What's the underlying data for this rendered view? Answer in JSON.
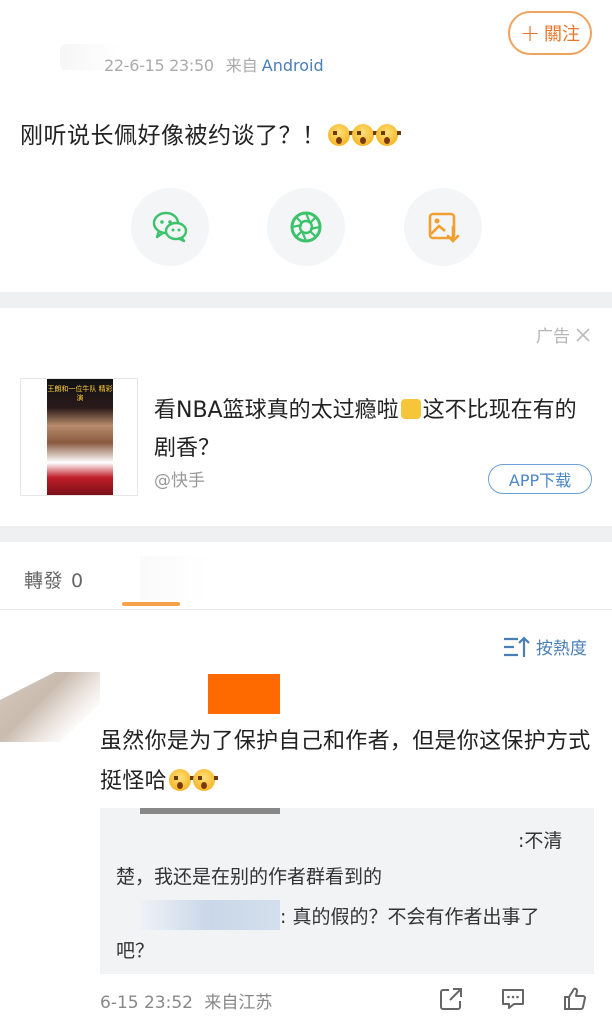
{
  "post": {
    "follow_label": "關注",
    "time": "22-6-15 23:50",
    "source_prefix": "来自",
    "device": "Android",
    "text": "刚听说长佩好像被约谈了？！",
    "share_icons": [
      "wechat-icon",
      "moments-icon",
      "save-image-icon"
    ]
  },
  "ad": {
    "tag": "广告",
    "title": "看NBA篮球真的太过瘾啦",
    "title_suffix": "这不比现在有的剧香？",
    "thumb_text": "王朗和一位牛队 精彩演",
    "source": "@快手",
    "download_label": "APP下载"
  },
  "repost": {
    "label": "轉發",
    "count": "0"
  },
  "comments": {
    "sort_label": "按熱度",
    "items": [
      {
        "text": "虽然你是为了保护自己和作者，但是你这保护方式挺怪哈",
        "replies": [
          {
            "text_a": ":不清",
            "text_b": "楚，我还是在别的作者群看到的"
          },
          {
            "text_a": ": 真的假的？不会有作者出事了",
            "text_b": "吧？"
          }
        ],
        "time": "6-15 23:52",
        "location": "来自江苏"
      }
    ]
  },
  "colors": {
    "accent_orange": "#e8762c",
    "link_blue": "#4a7fb5",
    "wechat_green": "#3cc26a",
    "separator": "#eef0f2"
  }
}
